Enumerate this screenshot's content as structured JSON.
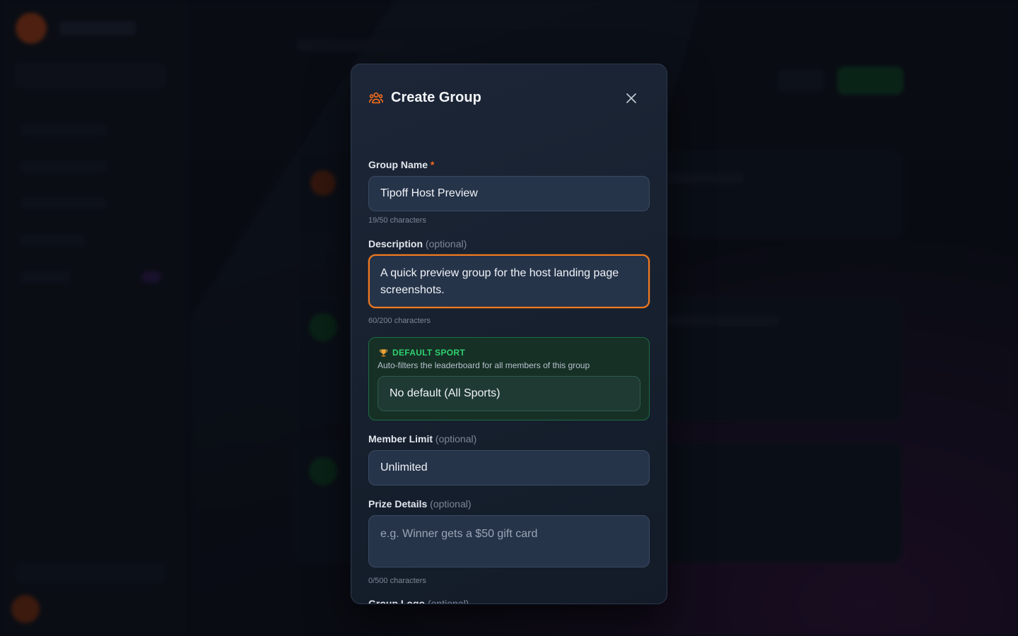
{
  "modal": {
    "title": "Create Group",
    "icon": "users-group-icon",
    "close_icon": "close-icon"
  },
  "group_name": {
    "label": "Group Name",
    "required_mark": "*",
    "value": "Tipoff Host Preview",
    "char_count": "19/50 characters"
  },
  "description": {
    "label": "Description",
    "optional": "(optional)",
    "value": "A quick preview group for the host landing page screenshots.",
    "char_count": "60/200 characters"
  },
  "default_sport": {
    "icon": "trophy-icon",
    "title": "DEFAULT SPORT",
    "description": "Auto-filters the leaderboard for all members of this group",
    "selected": "No default (All Sports)"
  },
  "member_limit": {
    "label": "Member Limit",
    "optional": "(optional)",
    "value": "Unlimited"
  },
  "prize_details": {
    "label": "Prize Details",
    "optional": "(optional)",
    "placeholder": "e.g. Winner gets a $50 gift card",
    "char_count": "0/500 characters"
  },
  "group_logo": {
    "label": "Group Logo",
    "optional": "(optional)"
  },
  "colors": {
    "accent_orange": "#f26a1b",
    "sport_green": "#2fd16f"
  }
}
